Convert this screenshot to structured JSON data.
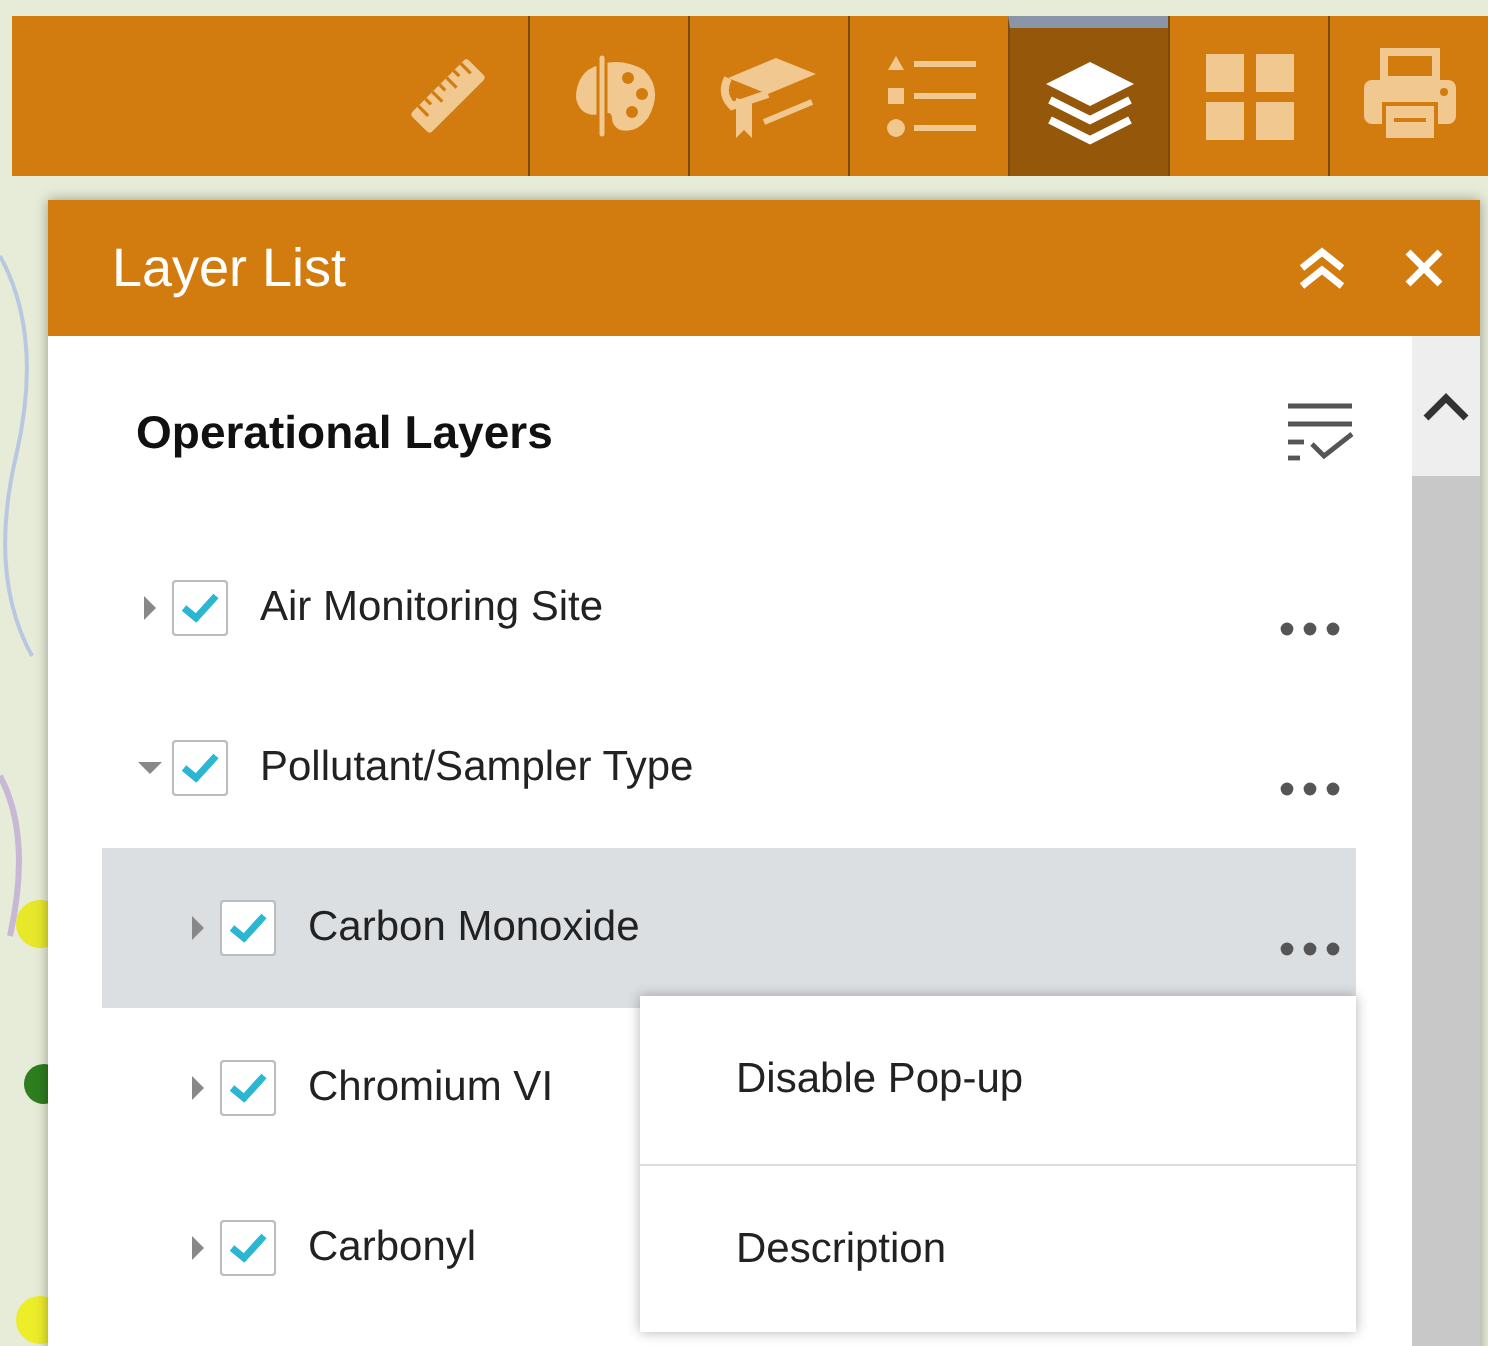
{
  "toolbar": {
    "buttons": [
      {
        "kind": "ruler",
        "selected": false
      },
      {
        "kind": "palette",
        "selected": false
      },
      {
        "kind": "cap",
        "selected": false
      },
      {
        "kind": "list",
        "selected": false
      },
      {
        "kind": "layers",
        "selected": true
      },
      {
        "kind": "grid",
        "selected": false
      },
      {
        "kind": "printer",
        "selected": false
      }
    ]
  },
  "panel": {
    "title": "Layer List"
  },
  "layers": {
    "heading": "Operational Layers",
    "items": [
      {
        "label": "Air Monitoring Site",
        "checked": true,
        "expanded": false,
        "selected": false
      },
      {
        "label": "Pollutant/Sampler Type",
        "checked": true,
        "expanded": true,
        "selected": false,
        "children": [
          {
            "label": "Carbon Monoxide",
            "checked": true,
            "expanded": false,
            "selected": true
          },
          {
            "label": "Chromium VI",
            "checked": true,
            "expanded": false,
            "selected": false
          },
          {
            "label": "Carbonyl",
            "checked": true,
            "expanded": false,
            "selected": false
          }
        ]
      }
    ]
  },
  "menu": {
    "items": [
      "Disable Pop-up",
      "Description"
    ]
  }
}
